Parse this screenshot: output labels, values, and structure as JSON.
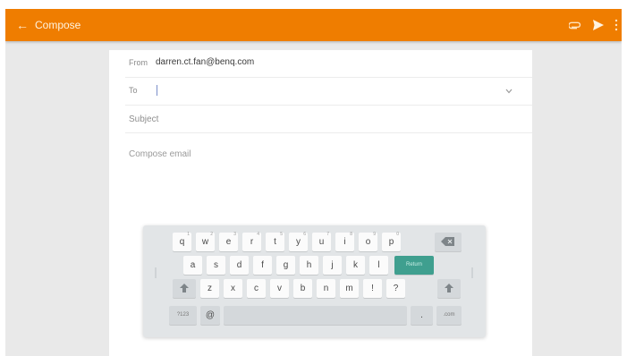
{
  "appbar": {
    "back_icon": "arrow-left-icon",
    "title": "Compose",
    "actions": [
      "attach-icon",
      "send-icon",
      "more-vertical-icon"
    ],
    "color": "#ef7d00"
  },
  "compose": {
    "from_label": "From",
    "from_value": "darren.ct.fan@benq.com",
    "to_label": "To",
    "to_value": "",
    "subject_placeholder": "Subject",
    "body_placeholder": "Compose email"
  },
  "keyboard": {
    "row1": [
      {
        "label": "q",
        "hint": "1"
      },
      {
        "label": "w",
        "hint": "2"
      },
      {
        "label": "e",
        "hint": "3"
      },
      {
        "label": "r",
        "hint": "4"
      },
      {
        "label": "t",
        "hint": "5"
      },
      {
        "label": "y",
        "hint": "6"
      },
      {
        "label": "u",
        "hint": "7"
      },
      {
        "label": "i",
        "hint": "8"
      },
      {
        "label": "o",
        "hint": "9"
      },
      {
        "label": "p",
        "hint": "0"
      }
    ],
    "row2": [
      "a",
      "s",
      "d",
      "f",
      "g",
      "h",
      "j",
      "k",
      "l"
    ],
    "return_label": "Return",
    "row3": [
      "z",
      "x",
      "c",
      "v",
      "b",
      "n",
      "m",
      "!",
      "?"
    ],
    "symbols_label": "?123",
    "at_label": "@",
    "period_label": ".",
    "dotcom_label": ".com",
    "accent_color": "#3f9f8f"
  }
}
